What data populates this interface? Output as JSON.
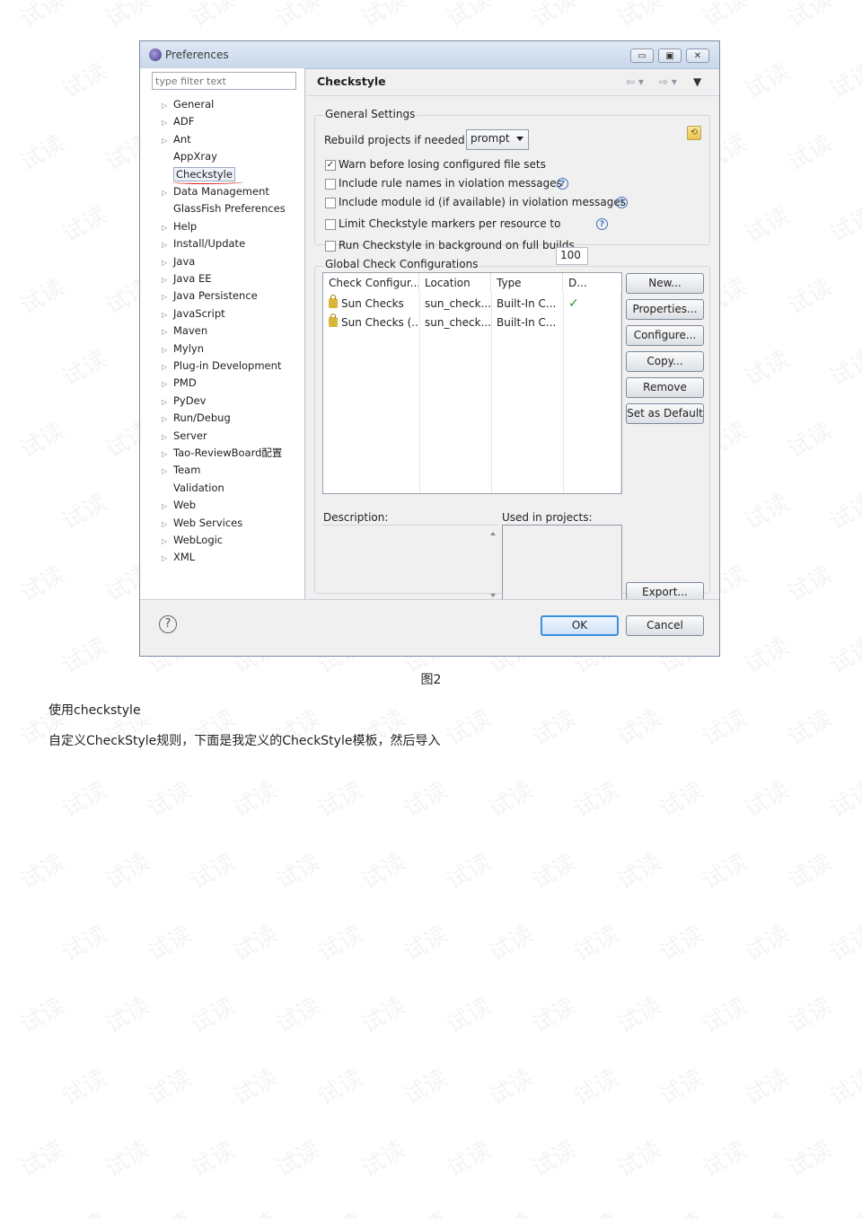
{
  "watermark": "试读",
  "dialog": {
    "title": "Preferences",
    "window_buttons": [
      "▭",
      "▣",
      "✕"
    ],
    "filter_placeholder": "type filter text",
    "tree": [
      {
        "label": "General",
        "arrow": true
      },
      {
        "label": "ADF",
        "arrow": true
      },
      {
        "label": "Ant",
        "arrow": true
      },
      {
        "label": "AppXray",
        "arrow": false
      },
      {
        "label": "Checkstyle",
        "arrow": false,
        "selected": true
      },
      {
        "label": "Data Management",
        "arrow": true
      },
      {
        "label": "GlassFish Preferences",
        "arrow": false
      },
      {
        "label": "Help",
        "arrow": true
      },
      {
        "label": "Install/Update",
        "arrow": true
      },
      {
        "label": "Java",
        "arrow": true
      },
      {
        "label": "Java EE",
        "arrow": true
      },
      {
        "label": "Java Persistence",
        "arrow": true
      },
      {
        "label": "JavaScript",
        "arrow": true
      },
      {
        "label": "Maven",
        "arrow": true
      },
      {
        "label": "Mylyn",
        "arrow": true
      },
      {
        "label": "Plug-in Development",
        "arrow": true
      },
      {
        "label": "PMD",
        "arrow": true
      },
      {
        "label": "PyDev",
        "arrow": true
      },
      {
        "label": "Run/Debug",
        "arrow": true
      },
      {
        "label": "Server",
        "arrow": true
      },
      {
        "label": "Tao-ReviewBoard配置",
        "arrow": true
      },
      {
        "label": "Team",
        "arrow": true
      },
      {
        "label": "Validation",
        "arrow": false
      },
      {
        "label": "Web",
        "arrow": true
      },
      {
        "label": "Web Services",
        "arrow": true
      },
      {
        "label": "WebLogic",
        "arrow": true
      },
      {
        "label": "XML",
        "arrow": true
      }
    ],
    "page_title": "Checkstyle",
    "general": {
      "group_label": "General Settings",
      "rebuild_label": "Rebuild projects if needed:",
      "rebuild_value": "prompt",
      "options": [
        {
          "label": "Warn before losing configured file sets",
          "checked": true,
          "help": false
        },
        {
          "label": "Include rule names in violation messages",
          "checked": false,
          "help": true
        },
        {
          "label": "Include module id (if available) in violation messages",
          "checked": false,
          "help": true
        },
        {
          "label": "Limit Checkstyle markers per resource to",
          "checked": false,
          "help": true
        },
        {
          "label": "Run Checkstyle in background on full builds",
          "checked": false,
          "help": false
        }
      ],
      "limit_value": "100"
    },
    "global": {
      "group_label": "Global Check Configurations",
      "columns": [
        "Check Configur...",
        "Location",
        "Type",
        "D..."
      ],
      "rows": [
        {
          "name": "Sun Checks",
          "location": "sun_check...",
          "type": "Built-In C...",
          "default": "✓"
        },
        {
          "name": "Sun Checks (...",
          "location": "sun_check...",
          "type": "Built-In C...",
          "default": ""
        }
      ],
      "buttons": [
        "New...",
        "Properties...",
        "Configure...",
        "Copy...",
        "Remove",
        "Set as Default"
      ],
      "description_label": "Description:",
      "used_label": "Used in projects:",
      "export_label": "Export..."
    },
    "footer": {
      "ok": "OK",
      "cancel": "Cancel"
    }
  },
  "caption": "图2",
  "paragraphs": [
    "使用checkstyle",
    "自定义CheckStyle规则，下面是我定义的CheckStyle模板，然后导入"
  ]
}
